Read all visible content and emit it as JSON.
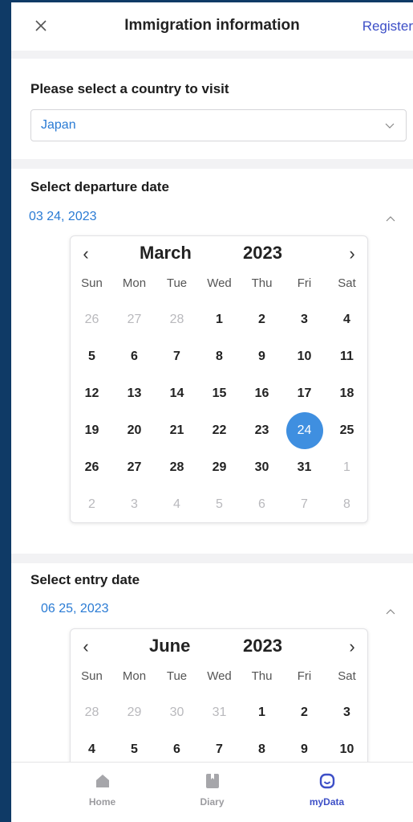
{
  "header": {
    "title": "Immigration information",
    "register": "Register"
  },
  "country": {
    "label": "Please select a country to visit",
    "value": "Japan"
  },
  "departure": {
    "label": "Select departure date",
    "value": "03 24, 2023",
    "calendar": {
      "month": "March",
      "year": "2023",
      "weekdays": [
        "Sun",
        "Mon",
        "Tue",
        "Wed",
        "Thu",
        "Fri",
        "Sat"
      ],
      "weeks": [
        [
          "26",
          "27",
          "28",
          "1",
          "2",
          "3",
          "4"
        ],
        [
          "5",
          "6",
          "7",
          "8",
          "9",
          "10",
          "11"
        ],
        [
          "12",
          "13",
          "14",
          "15",
          "16",
          "17",
          "18"
        ],
        [
          "19",
          "20",
          "21",
          "22",
          "23",
          "24",
          "25"
        ],
        [
          "26",
          "27",
          "28",
          "29",
          "30",
          "31",
          "1"
        ],
        [
          "2",
          "3",
          "4",
          "5",
          "6",
          "7",
          "8"
        ]
      ],
      "selected": "24"
    }
  },
  "entry": {
    "label": "Select entry date",
    "value": "06 25, 2023",
    "calendar": {
      "month": "June",
      "year": "2023",
      "weekdays": [
        "Sun",
        "Mon",
        "Tue",
        "Wed",
        "Thu",
        "Fri",
        "Sat"
      ],
      "weeks": [
        [
          "28",
          "29",
          "30",
          "31",
          "1",
          "2",
          "3"
        ],
        [
          "4",
          "5",
          "6",
          "7",
          "8",
          "9",
          "10"
        ]
      ]
    }
  },
  "tabs": [
    {
      "label": "Home",
      "icon": "home-icon"
    },
    {
      "label": "Diary",
      "icon": "diary-icon"
    },
    {
      "label": "myData",
      "icon": "mydata-icon"
    }
  ],
  "colors": {
    "accent": "#3d4fc7",
    "link": "#2a7bd4",
    "selected": "#3f8fe0"
  }
}
